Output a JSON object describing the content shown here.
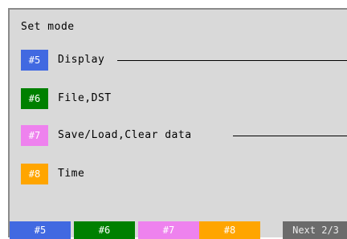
{
  "title": "Set mode",
  "menu": [
    {
      "key": "#5",
      "label": "Display",
      "color": "#4169e1",
      "has_line": true
    },
    {
      "key": "#6",
      "label": "File,DST",
      "color": "#008000",
      "has_line": false
    },
    {
      "key": "#7",
      "label": "Save/Load,Clear data",
      "color": "#ee82ee",
      "has_line": true
    },
    {
      "key": "#8",
      "label": "Time",
      "color": "#ffa500",
      "has_line": false
    }
  ],
  "function_keys": [
    {
      "label": "#5",
      "color": "#4169e1"
    },
    {
      "label": "#6",
      "color": "#008000"
    },
    {
      "label": "#7",
      "color": "#ee82ee"
    },
    {
      "label": "#8",
      "color": "#ffa500"
    },
    {
      "label": "Next 2/3",
      "color": "#6b6b6b"
    }
  ]
}
